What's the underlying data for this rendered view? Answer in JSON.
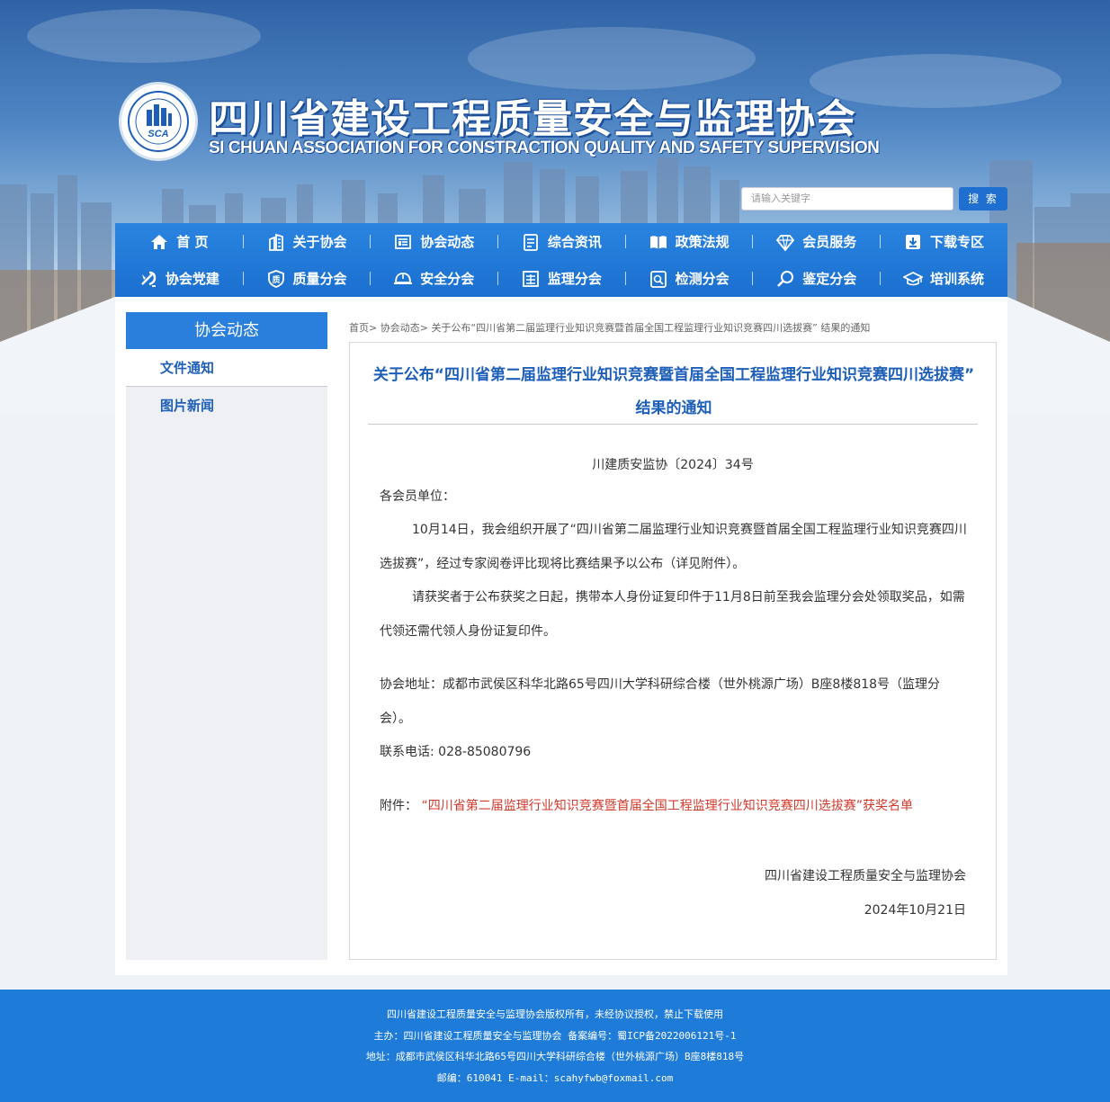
{
  "header": {
    "title": "四川省建设工程质量安全与监理协会",
    "subtitle": "SI CHUAN ASSOCIATION FOR CONSTRACTION QUALITY AND SAFETY SUPERVISION",
    "logo_text": "SCA"
  },
  "search": {
    "placeholder": "请输入关键字",
    "button": "搜 索"
  },
  "nav": {
    "row1": [
      {
        "label": "首 页",
        "icon": "home-icon"
      },
      {
        "label": "关于协会",
        "icon": "building-icon"
      },
      {
        "label": "协会动态",
        "icon": "news-icon"
      },
      {
        "label": "综合资讯",
        "icon": "document-icon"
      },
      {
        "label": "政策法规",
        "icon": "book-icon"
      },
      {
        "label": "会员服务",
        "icon": "diamond-icon"
      },
      {
        "label": "下载专区",
        "icon": "download-icon"
      }
    ],
    "row2": [
      {
        "label": "协会党建",
        "icon": "party-icon"
      },
      {
        "label": "质量分会",
        "icon": "quality-icon"
      },
      {
        "label": "安全分会",
        "icon": "helmet-icon"
      },
      {
        "label": "监理分会",
        "icon": "supervision-icon"
      },
      {
        "label": "检测分会",
        "icon": "inspection-icon"
      },
      {
        "label": "鉴定分会",
        "icon": "magnifier-icon"
      },
      {
        "label": "培训系统",
        "icon": "graduation-cap-icon"
      }
    ]
  },
  "sidebar": {
    "heading": "协会动态",
    "items": [
      {
        "label": "文件通知"
      },
      {
        "label": "图片新闻"
      }
    ]
  },
  "breadcrumb": {
    "home": "首页",
    "sep": ">",
    "section": "协会动态",
    "current": "关于公布“四川省第二届监理行业知识竞赛暨首届全国工程监理行业知识竞赛四川选拔赛” 结果的通知"
  },
  "article": {
    "title": "关于公布“四川省第二届监理行业知识竞赛暨首届全国工程监理行业知识竞赛四川选拔赛” 结果的通知",
    "doc_no": "川建质安监协〔2024〕34号",
    "salutation": "各会员单位：",
    "para1": "10月14日，我会组织开展了“四川省第二届监理行业知识竞赛暨首届全国工程监理行业知识竞赛四川选拔赛”，经过专家阅卷评比现将比赛结果予以公布（详见附件）。",
    "para2": "请获奖者于公布获奖之日起，携带本人身份证复印件于11月8日前至我会监理分会处领取奖品，如需代领还需代领人身份证复印件。",
    "address": "协会地址：成都市武侯区科华北路65号四川大学科研综合楼（世外桃源广场）B座8楼818号（监理分会）。",
    "phone": "联系电话: 028-85080796",
    "attach_label": "附件：",
    "attach_link": "“四川省第二届监理行业知识竞赛暨首届全国工程监理行业知识竞赛四川选拔赛”获奖名单",
    "sign_org": "四川省建设工程质量安全与监理协会",
    "sign_date": "2024年10月21日"
  },
  "footer": {
    "line1": "四川省建设工程质量安全与监理协会版权所有，未经协议授权，禁止下载使用",
    "line2": "主办：四川省建设工程质量安全与监理协会 备案编号：蜀ICP备2022006121号-1",
    "line3": "地址：成都市武侯区科华北路65号四川大学科研综合楼（世外桃源广场）B座8楼818号",
    "line4": "邮编：610041 E-mail：scahyfwb@foxmail.com"
  },
  "colors": {
    "primary": "#1f6fd1",
    "nav": "#2a84e0",
    "title": "#1d5fb8",
    "attachment": "#d0392b",
    "footer": "#1f7bd8"
  }
}
